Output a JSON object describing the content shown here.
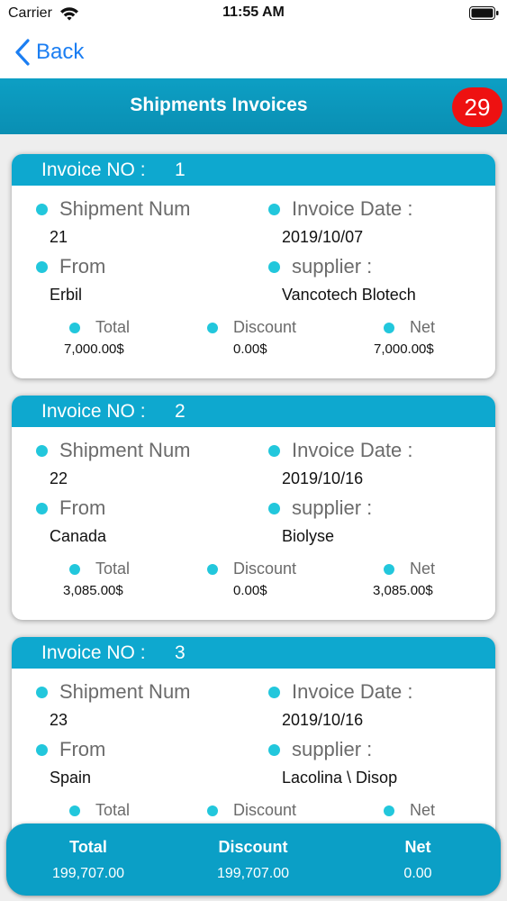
{
  "status_bar": {
    "carrier": "Carrier",
    "time": "11:55 AM"
  },
  "nav": {
    "back_label": "Back"
  },
  "header": {
    "title": "Shipments Invoices",
    "count": "29"
  },
  "labels": {
    "invoice_no": "Invoice NO :",
    "shipment_num": "Shipment Num",
    "invoice_date": "Invoice Date :",
    "from": "From",
    "supplier": "supplier :",
    "total": "Total",
    "discount": "Discount",
    "net": "Net"
  },
  "invoices": [
    {
      "no": "1",
      "shipment_num": "21",
      "invoice_date": "2019/10/07",
      "from": "Erbil",
      "supplier": "Vancotech Blotech",
      "total": "7,000.00$",
      "discount": "0.00$",
      "net": "7,000.00$"
    },
    {
      "no": "2",
      "shipment_num": "22",
      "invoice_date": "2019/10/16",
      "from": "Canada",
      "supplier": "Biolyse",
      "total": "3,085.00$",
      "discount": "0.00$",
      "net": "3,085.00$"
    },
    {
      "no": "3",
      "shipment_num": "23",
      "invoice_date": "2019/10/16",
      "from": "Spain",
      "supplier": "Lacolina \\ Disop",
      "total": "",
      "discount": "",
      "net": ""
    }
  ],
  "footer": {
    "total_label": "Total",
    "total_value": "199,707.00",
    "discount_label": "Discount",
    "discount_value": "199,707.00",
    "net_label": "Net",
    "net_value": "0.00"
  }
}
